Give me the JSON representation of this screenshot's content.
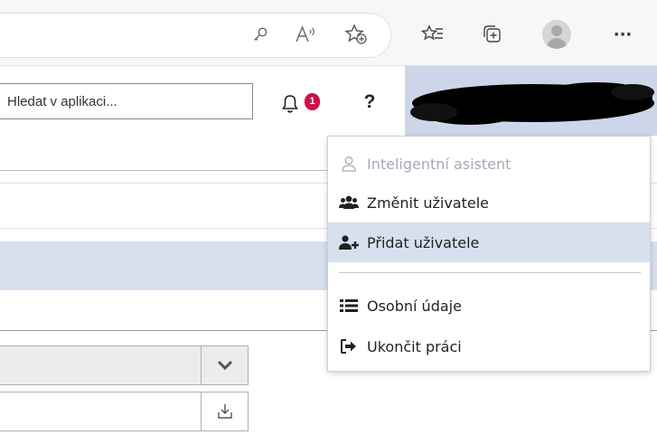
{
  "browser": {
    "toolbar_icons": [
      "key-icon",
      "read-aloud-icon",
      "add-favorite-icon",
      "favorites-icon",
      "collections-icon",
      "profile-avatar",
      "more-icon"
    ],
    "more_label": "···"
  },
  "header": {
    "search": {
      "placeholder": "Hledat v aplikaci..."
    },
    "notifications": {
      "count": "1"
    },
    "help_label": "?"
  },
  "user_menu": {
    "items": [
      {
        "label": "Inteligentní asistent",
        "icon": "person-outline-icon",
        "disabled": true
      },
      {
        "label": "Změnit uživatele",
        "icon": "users-icon"
      },
      {
        "label": "Přidat uživatele",
        "icon": "user-plus-icon",
        "highlighted": true
      },
      {
        "label": "Osobní údaje",
        "icon": "list-icon"
      },
      {
        "label": "Ukončit práci",
        "icon": "sign-out-icon"
      }
    ]
  },
  "colors": {
    "badge": "#d0104c",
    "user_area": "#ccd6e8",
    "highlight": "#d7e0ef",
    "disabled_text": "#a3a9b8"
  }
}
